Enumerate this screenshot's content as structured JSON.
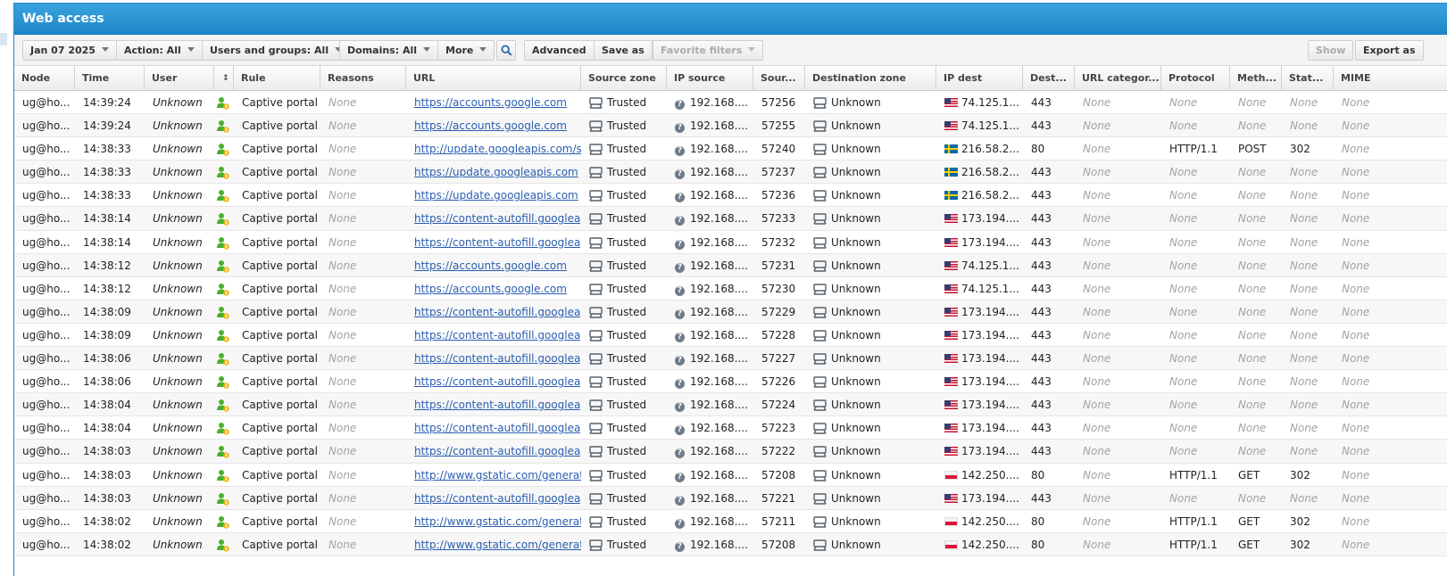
{
  "window": {
    "title": "Web access"
  },
  "toolbar": {
    "date": "Jan 07 2025",
    "action": "Action: All",
    "users": "Users and groups: All",
    "domains": "Domains: All",
    "more": "More",
    "advanced": "Advanced",
    "save_as": "Save as",
    "favorite_filters": "Favorite filters",
    "show": "Show",
    "export": "Export as"
  },
  "columns": {
    "node": "Node",
    "time": "Time",
    "user": "User",
    "sort": "↕",
    "rule": "Rule",
    "reasons": "Reasons",
    "url": "URL",
    "source_zone": "Source zone",
    "ip_source": "IP source",
    "source_port": "Sour...",
    "destination_zone": "Destination zone",
    "ip_dest": "IP dest",
    "dest_port": "Dest...",
    "url_category": "URL categor...",
    "protocol": "Protocol",
    "method": "Meth...",
    "status": "Stat...",
    "mime": "MIME"
  },
  "rows": [
    {
      "node": "ug@ho...",
      "time": "14:39:24",
      "user": "Unknown",
      "rule": "Captive portal",
      "reasons": "None",
      "url": "https://accounts.google.com",
      "source_zone": "Trusted",
      "ip_source": "192.168....",
      "source_port": "57256",
      "destination_zone": "Unknown",
      "flag": "us",
      "ip_dest": "74.125.1...",
      "dest_port": "443",
      "url_category": "None",
      "protocol": "None",
      "method": "None",
      "status": "None",
      "mime": "None"
    },
    {
      "node": "ug@ho...",
      "time": "14:39:24",
      "user": "Unknown",
      "rule": "Captive portal",
      "reasons": "None",
      "url": "https://accounts.google.com",
      "source_zone": "Trusted",
      "ip_source": "192.168....",
      "source_port": "57255",
      "destination_zone": "Unknown",
      "flag": "us",
      "ip_dest": "74.125.1...",
      "dest_port": "443",
      "url_category": "None",
      "protocol": "None",
      "method": "None",
      "status": "None",
      "mime": "None"
    },
    {
      "node": "ug@ho...",
      "time": "14:38:33",
      "user": "Unknown",
      "rule": "Captive portal",
      "reasons": "None",
      "url": "http://update.googleapis.com/s...",
      "source_zone": "Trusted",
      "ip_source": "192.168....",
      "source_port": "57240",
      "destination_zone": "Unknown",
      "flag": "se",
      "ip_dest": "216.58.2...",
      "dest_port": "80",
      "url_category": "None",
      "protocol": "HTTP/1.1",
      "method": "POST",
      "status": "302",
      "mime": "None"
    },
    {
      "node": "ug@ho...",
      "time": "14:38:33",
      "user": "Unknown",
      "rule": "Captive portal",
      "reasons": "None",
      "url": "https://update.googleapis.com",
      "source_zone": "Trusted",
      "ip_source": "192.168....",
      "source_port": "57237",
      "destination_zone": "Unknown",
      "flag": "se",
      "ip_dest": "216.58.2...",
      "dest_port": "443",
      "url_category": "None",
      "protocol": "None",
      "method": "None",
      "status": "None",
      "mime": "None"
    },
    {
      "node": "ug@ho...",
      "time": "14:38:33",
      "user": "Unknown",
      "rule": "Captive portal",
      "reasons": "None",
      "url": "https://update.googleapis.com",
      "source_zone": "Trusted",
      "ip_source": "192.168....",
      "source_port": "57236",
      "destination_zone": "Unknown",
      "flag": "se",
      "ip_dest": "216.58.2...",
      "dest_port": "443",
      "url_category": "None",
      "protocol": "None",
      "method": "None",
      "status": "None",
      "mime": "None"
    },
    {
      "node": "ug@ho...",
      "time": "14:38:14",
      "user": "Unknown",
      "rule": "Captive portal",
      "reasons": "None",
      "url": "https://content-autofill.googleap...",
      "source_zone": "Trusted",
      "ip_source": "192.168....",
      "source_port": "57233",
      "destination_zone": "Unknown",
      "flag": "us",
      "ip_dest": "173.194....",
      "dest_port": "443",
      "url_category": "None",
      "protocol": "None",
      "method": "None",
      "status": "None",
      "mime": "None"
    },
    {
      "node": "ug@ho...",
      "time": "14:38:14",
      "user": "Unknown",
      "rule": "Captive portal",
      "reasons": "None",
      "url": "https://content-autofill.googleap...",
      "source_zone": "Trusted",
      "ip_source": "192.168....",
      "source_port": "57232",
      "destination_zone": "Unknown",
      "flag": "us",
      "ip_dest": "173.194....",
      "dest_port": "443",
      "url_category": "None",
      "protocol": "None",
      "method": "None",
      "status": "None",
      "mime": "None"
    },
    {
      "node": "ug@ho...",
      "time": "14:38:12",
      "user": "Unknown",
      "rule": "Captive portal",
      "reasons": "None",
      "url": "https://accounts.google.com",
      "source_zone": "Trusted",
      "ip_source": "192.168....",
      "source_port": "57231",
      "destination_zone": "Unknown",
      "flag": "us",
      "ip_dest": "74.125.1...",
      "dest_port": "443",
      "url_category": "None",
      "protocol": "None",
      "method": "None",
      "status": "None",
      "mime": "None"
    },
    {
      "node": "ug@ho...",
      "time": "14:38:12",
      "user": "Unknown",
      "rule": "Captive portal",
      "reasons": "None",
      "url": "https://accounts.google.com",
      "source_zone": "Trusted",
      "ip_source": "192.168....",
      "source_port": "57230",
      "destination_zone": "Unknown",
      "flag": "us",
      "ip_dest": "74.125.1...",
      "dest_port": "443",
      "url_category": "None",
      "protocol": "None",
      "method": "None",
      "status": "None",
      "mime": "None"
    },
    {
      "node": "ug@ho...",
      "time": "14:38:09",
      "user": "Unknown",
      "rule": "Captive portal",
      "reasons": "None",
      "url": "https://content-autofill.googleap...",
      "source_zone": "Trusted",
      "ip_source": "192.168....",
      "source_port": "57229",
      "destination_zone": "Unknown",
      "flag": "us",
      "ip_dest": "173.194....",
      "dest_port": "443",
      "url_category": "None",
      "protocol": "None",
      "method": "None",
      "status": "None",
      "mime": "None"
    },
    {
      "node": "ug@ho...",
      "time": "14:38:09",
      "user": "Unknown",
      "rule": "Captive portal",
      "reasons": "None",
      "url": "https://content-autofill.googleap...",
      "source_zone": "Trusted",
      "ip_source": "192.168....",
      "source_port": "57228",
      "destination_zone": "Unknown",
      "flag": "us",
      "ip_dest": "173.194....",
      "dest_port": "443",
      "url_category": "None",
      "protocol": "None",
      "method": "None",
      "status": "None",
      "mime": "None"
    },
    {
      "node": "ug@ho...",
      "time": "14:38:06",
      "user": "Unknown",
      "rule": "Captive portal",
      "reasons": "None",
      "url": "https://content-autofill.googleap...",
      "source_zone": "Trusted",
      "ip_source": "192.168....",
      "source_port": "57227",
      "destination_zone": "Unknown",
      "flag": "us",
      "ip_dest": "173.194....",
      "dest_port": "443",
      "url_category": "None",
      "protocol": "None",
      "method": "None",
      "status": "None",
      "mime": "None"
    },
    {
      "node": "ug@ho...",
      "time": "14:38:06",
      "user": "Unknown",
      "rule": "Captive portal",
      "reasons": "None",
      "url": "https://content-autofill.googleap...",
      "source_zone": "Trusted",
      "ip_source": "192.168....",
      "source_port": "57226",
      "destination_zone": "Unknown",
      "flag": "us",
      "ip_dest": "173.194....",
      "dest_port": "443",
      "url_category": "None",
      "protocol": "None",
      "method": "None",
      "status": "None",
      "mime": "None"
    },
    {
      "node": "ug@ho...",
      "time": "14:38:04",
      "user": "Unknown",
      "rule": "Captive portal",
      "reasons": "None",
      "url": "https://content-autofill.googleap...",
      "source_zone": "Trusted",
      "ip_source": "192.168....",
      "source_port": "57224",
      "destination_zone": "Unknown",
      "flag": "us",
      "ip_dest": "173.194....",
      "dest_port": "443",
      "url_category": "None",
      "protocol": "None",
      "method": "None",
      "status": "None",
      "mime": "None"
    },
    {
      "node": "ug@ho...",
      "time": "14:38:04",
      "user": "Unknown",
      "rule": "Captive portal",
      "reasons": "None",
      "url": "https://content-autofill.googleap...",
      "source_zone": "Trusted",
      "ip_source": "192.168....",
      "source_port": "57223",
      "destination_zone": "Unknown",
      "flag": "us",
      "ip_dest": "173.194....",
      "dest_port": "443",
      "url_category": "None",
      "protocol": "None",
      "method": "None",
      "status": "None",
      "mime": "None"
    },
    {
      "node": "ug@ho...",
      "time": "14:38:03",
      "user": "Unknown",
      "rule": "Captive portal",
      "reasons": "None",
      "url": "https://content-autofill.googleap...",
      "source_zone": "Trusted",
      "ip_source": "192.168....",
      "source_port": "57222",
      "destination_zone": "Unknown",
      "flag": "us",
      "ip_dest": "173.194....",
      "dest_port": "443",
      "url_category": "None",
      "protocol": "None",
      "method": "None",
      "status": "None",
      "mime": "None"
    },
    {
      "node": "ug@ho...",
      "time": "14:38:03",
      "user": "Unknown",
      "rule": "Captive portal",
      "reasons": "None",
      "url": "http://www.gstatic.com/generat...",
      "source_zone": "Trusted",
      "ip_source": "192.168....",
      "source_port": "57208",
      "destination_zone": "Unknown",
      "flag": "pl",
      "ip_dest": "142.250....",
      "dest_port": "80",
      "url_category": "None",
      "protocol": "HTTP/1.1",
      "method": "GET",
      "status": "302",
      "mime": "None"
    },
    {
      "node": "ug@ho...",
      "time": "14:38:03",
      "user": "Unknown",
      "rule": "Captive portal",
      "reasons": "None",
      "url": "https://content-autofill.googleap...",
      "source_zone": "Trusted",
      "ip_source": "192.168....",
      "source_port": "57221",
      "destination_zone": "Unknown",
      "flag": "us",
      "ip_dest": "173.194....",
      "dest_port": "443",
      "url_category": "None",
      "protocol": "None",
      "method": "None",
      "status": "None",
      "mime": "None"
    },
    {
      "node": "ug@ho...",
      "time": "14:38:02",
      "user": "Unknown",
      "rule": "Captive portal",
      "reasons": "None",
      "url": "http://www.gstatic.com/generat...",
      "source_zone": "Trusted",
      "ip_source": "192.168....",
      "source_port": "57211",
      "destination_zone": "Unknown",
      "flag": "pl",
      "ip_dest": "142.250....",
      "dest_port": "80",
      "url_category": "None",
      "protocol": "HTTP/1.1",
      "method": "GET",
      "status": "302",
      "mime": "None"
    },
    {
      "node": "ug@ho...",
      "time": "14:38:02",
      "user": "Unknown",
      "rule": "Captive portal",
      "reasons": "None",
      "url": "http://www.gstatic.com/generat...",
      "source_zone": "Trusted",
      "ip_source": "192.168....",
      "source_port": "57208",
      "destination_zone": "Unknown",
      "flag": "pl",
      "ip_dest": "142.250....",
      "dest_port": "80",
      "url_category": "None",
      "protocol": "HTTP/1.1",
      "method": "GET",
      "status": "302",
      "mime": "None"
    }
  ]
}
